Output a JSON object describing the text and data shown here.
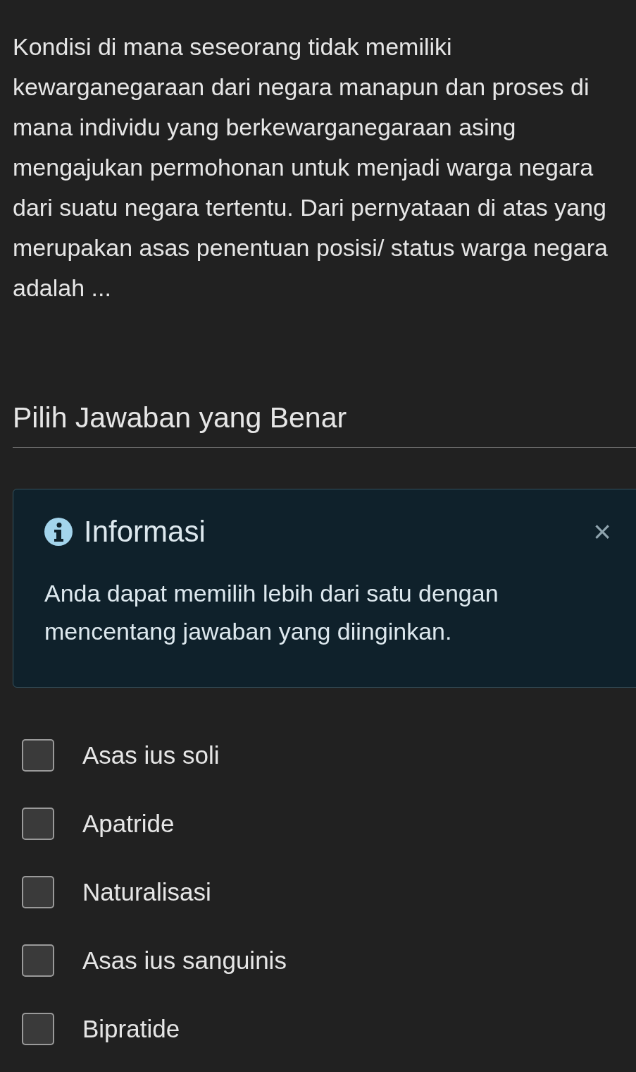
{
  "question": "Kondisi di mana seseorang tidak memiliki kewarganegaraan dari negara manapun dan proses di mana individu yang berkewarganegaraan asing mengajukan permohonan untuk menjadi warga negara dari suatu negara tertentu. Dari pernyataan di atas yang merupakan asas penentuan posisi/ status warga negara adalah ...",
  "heading": "Pilih Jawaban yang Benar",
  "info": {
    "title": "Informasi",
    "close": "×",
    "body": "Anda dapat memilih lebih dari satu dengan mencentang jawaban yang diinginkan."
  },
  "options": [
    {
      "label": "Asas ius soli",
      "checked": false
    },
    {
      "label": "Apatride",
      "checked": false
    },
    {
      "label": "Naturalisasi",
      "checked": false
    },
    {
      "label": "Asas ius sanguinis",
      "checked": false
    },
    {
      "label": "Bipratide",
      "checked": false
    }
  ]
}
